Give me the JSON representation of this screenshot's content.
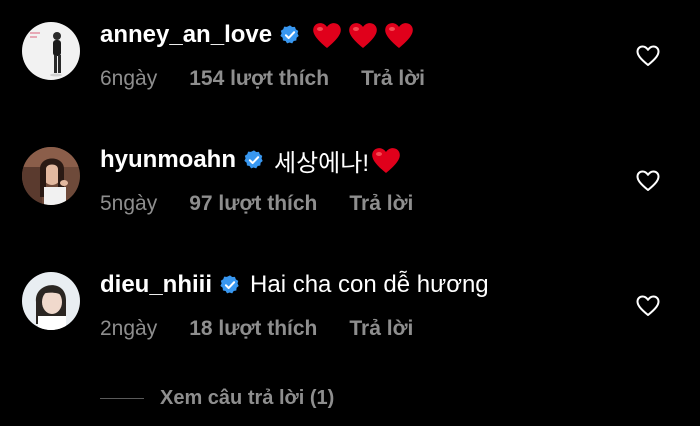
{
  "comments": [
    {
      "username": "anney_an_love",
      "text": "",
      "emoji_hearts": 3,
      "time": "6ngày",
      "likes": "154 lượt thích",
      "reply": "Trả lời"
    },
    {
      "username": "hyunmoahn",
      "text": "세상에나!",
      "emoji_hearts": 1,
      "time": "5ngày",
      "likes": "97 lượt thích",
      "reply": "Trả lời"
    },
    {
      "username": "dieu_nhiii",
      "text": "Hai cha con dễ hương",
      "emoji_hearts": 0,
      "time": "2ngày",
      "likes": "18 lượt thích",
      "reply": "Trả lời"
    }
  ],
  "view_replies": "Xem câu trả lời (1)",
  "colors": {
    "background": "#000000",
    "text": "#ffffff",
    "muted": "#8e8e8e",
    "verified": "#3897f0",
    "heart_emoji": "#e0001b"
  },
  "icons": {
    "verified": "verified-badge-icon",
    "like": "heart-outline-icon",
    "emoji": "red-heart-emoji-icon"
  }
}
